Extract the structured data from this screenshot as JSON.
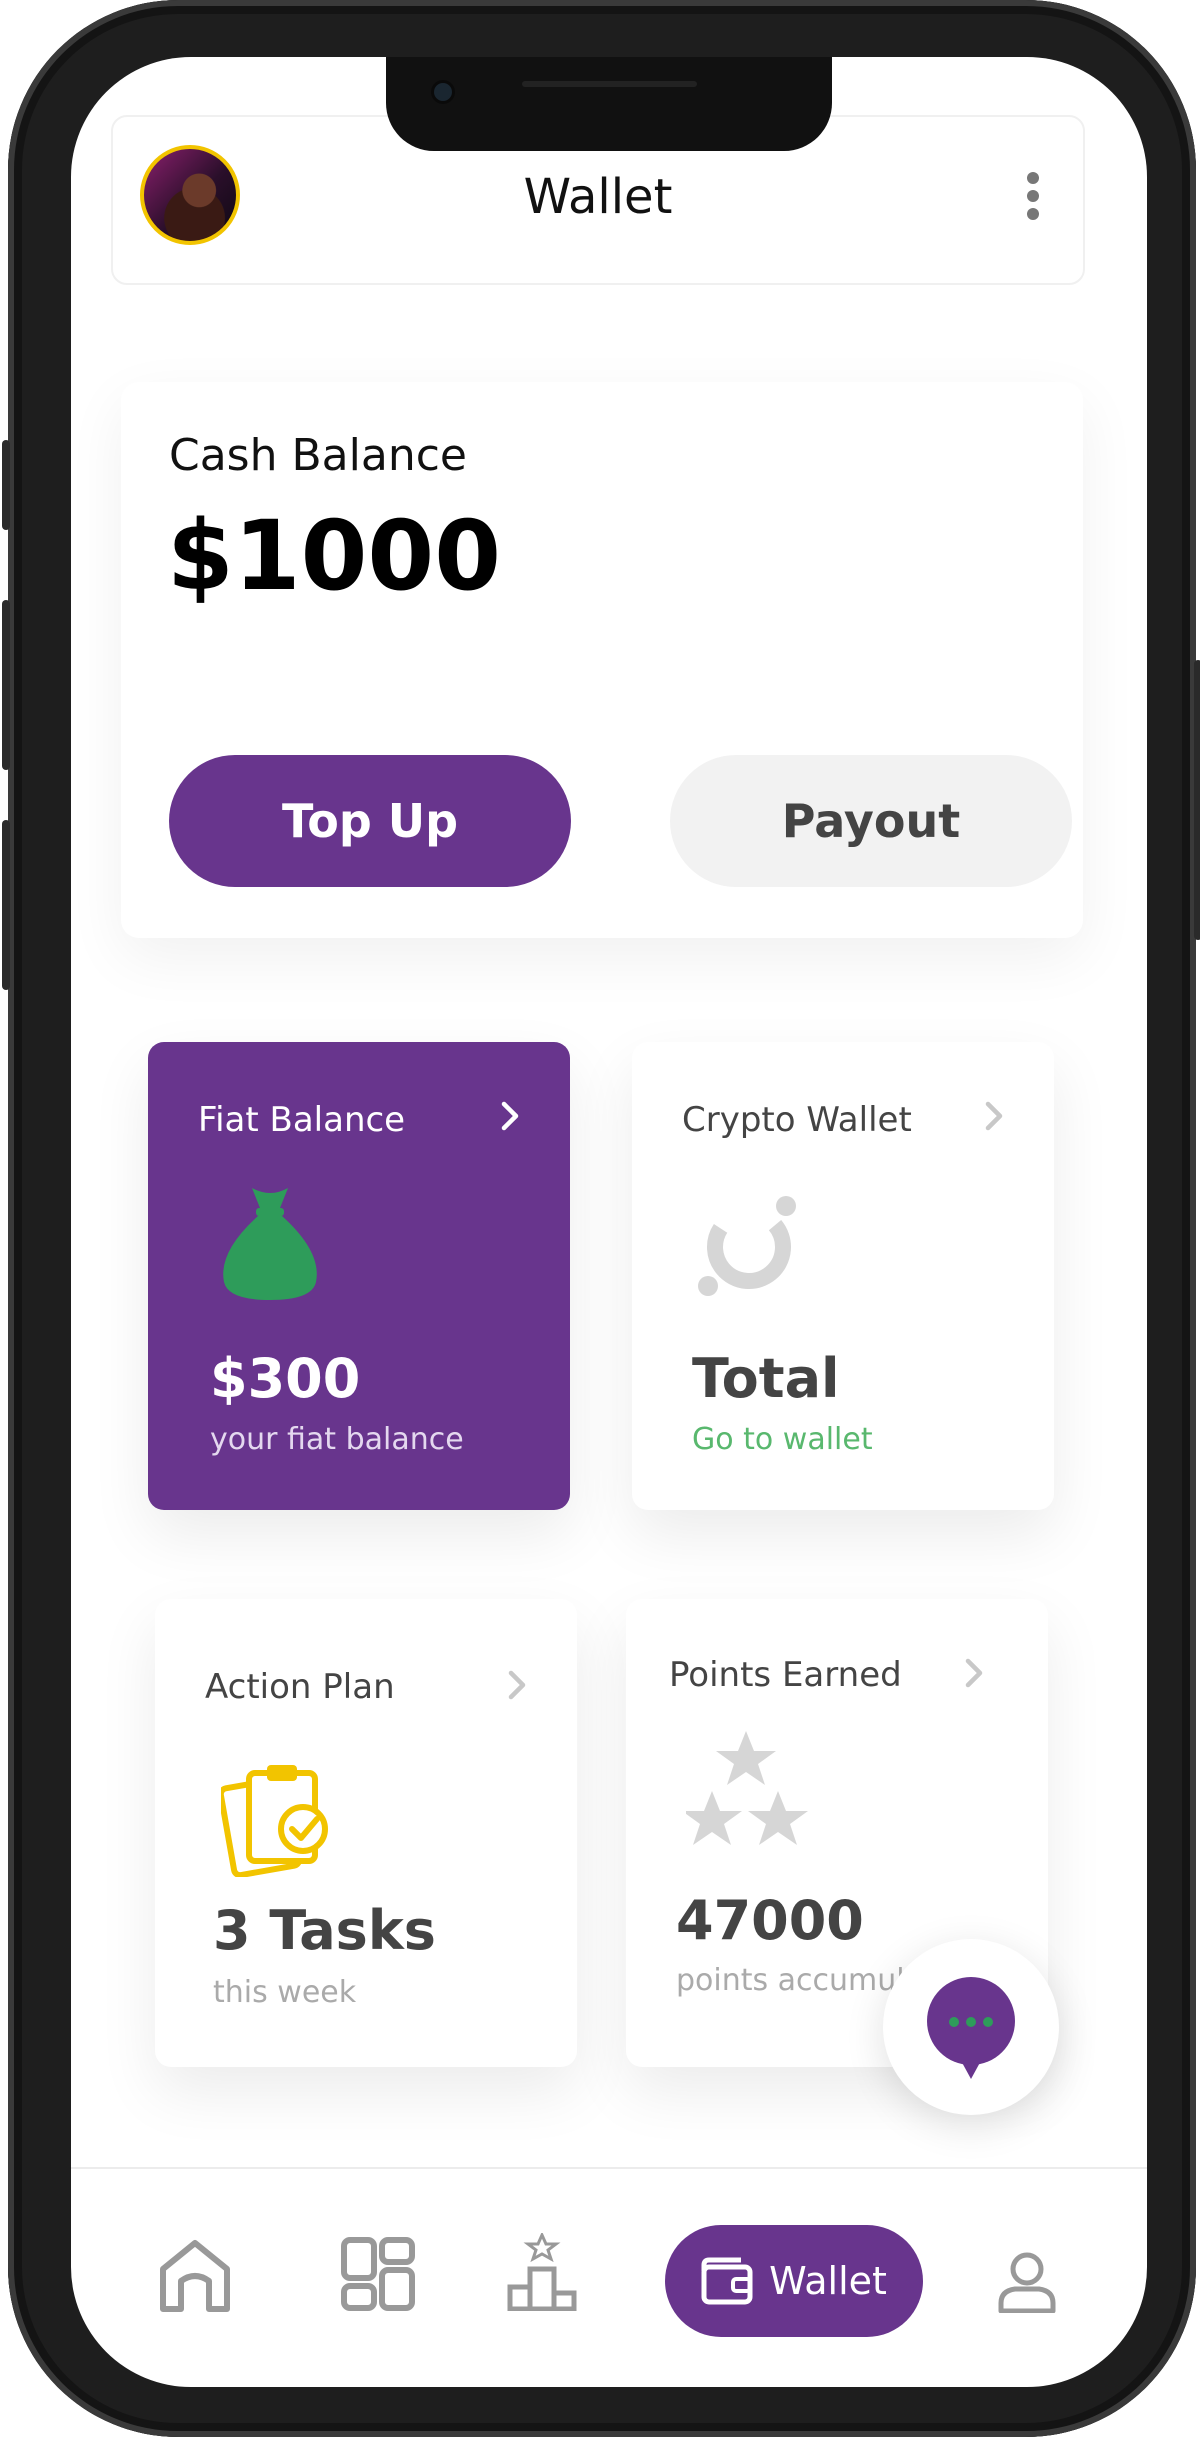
{
  "header": {
    "title": "Wallet"
  },
  "cash": {
    "label": "Cash Balance",
    "value": "$1000",
    "top_up_label": "Top Up",
    "payout_label": "Payout"
  },
  "tiles": {
    "fiat": {
      "title": "Fiat Balance",
      "value": "$300",
      "sub": "your fiat balance"
    },
    "crypto": {
      "title": "Crypto Wallet",
      "value": "Total",
      "sub": "Go to wallet"
    },
    "action": {
      "title": "Action Plan",
      "value": "3 Tasks",
      "sub": "this week"
    },
    "points": {
      "title": "Points Earned",
      "value": "47000",
      "sub": "points accumulated"
    }
  },
  "nav": {
    "items": [
      "home",
      "dashboard",
      "leaderboard",
      "wallet",
      "profile"
    ],
    "active_label": "Wallet"
  },
  "colors": {
    "brand": "#68358d",
    "accent_green": "#2e9c5a",
    "link_green": "#59b86e",
    "tasks_yellow": "#f2c400"
  }
}
